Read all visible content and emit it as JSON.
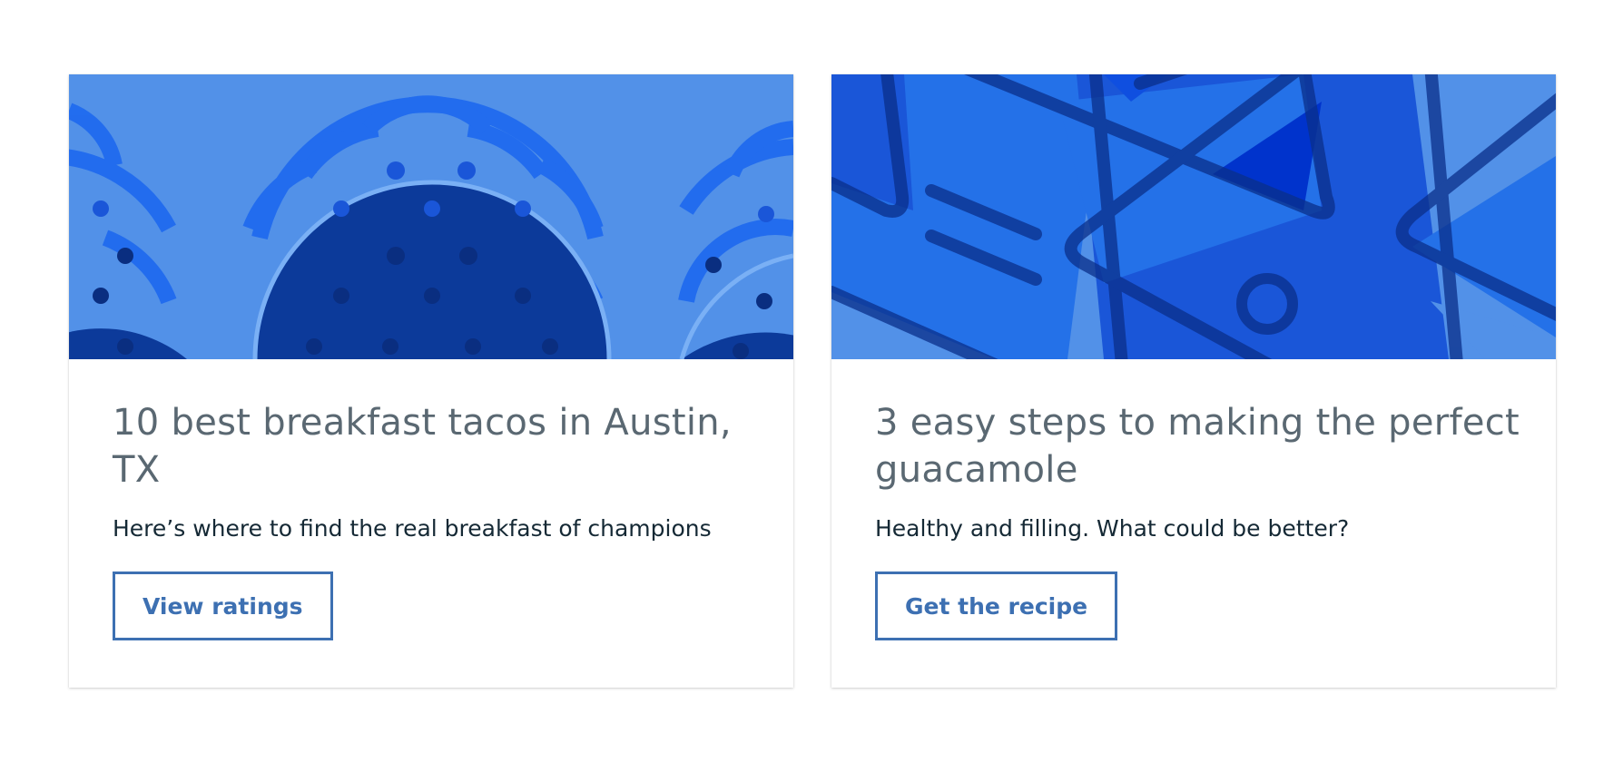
{
  "cards": [
    {
      "title": "10 best breakfast tacos in Austin, TX",
      "subtitle": "Here’s where to find the real breakfast of champions",
      "button_label": "View ratings",
      "illustration": "tacos-pattern",
      "colors": {
        "background": "#5291e8",
        "mid": "#0f62fe",
        "dark": "#0c3a9a"
      }
    },
    {
      "title": "3 easy steps to making the perfect guacamole",
      "subtitle": "Healthy and filling. What could be better?",
      "button_label": "Get the recipe",
      "illustration": "geometric-pattern",
      "colors": {
        "background": "#2471e8",
        "mid": "#0f4fe0",
        "dark": "#0a2f8a"
      }
    }
  ],
  "colors": {
    "title": "#5a6872",
    "text": "#152935",
    "accent": "#3d70b2"
  }
}
